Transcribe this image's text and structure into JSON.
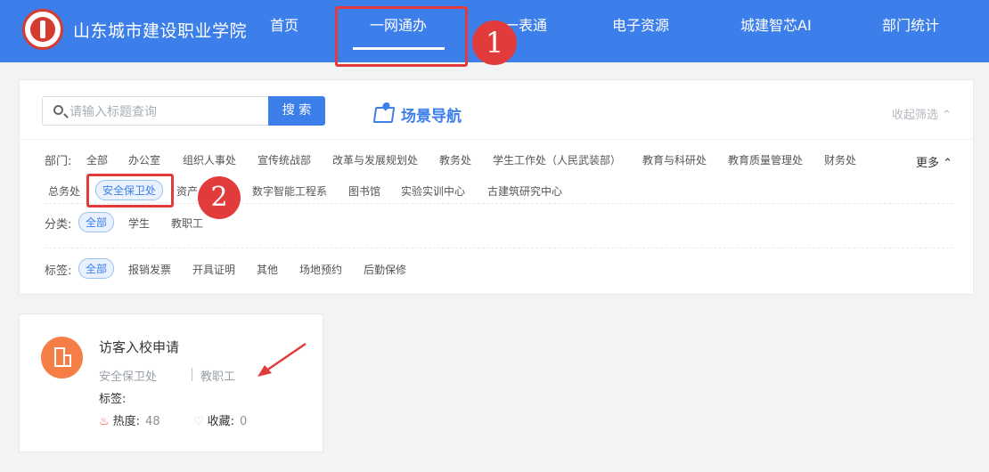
{
  "header": {
    "school_name": "山东城市建设职业学院",
    "nav": [
      "首页",
      "一网通办",
      "一表通",
      "电子资源",
      "城建智芯AI",
      "部门统计"
    ],
    "active_nav": "一网通办"
  },
  "annotations": [
    "1",
    "2"
  ],
  "search": {
    "placeholder": "请输入标题查询",
    "button_label": "搜 索"
  },
  "scene_nav_title": "场景导航",
  "collapse_label": "收起筛选",
  "filters": {
    "dept_label": "部门:",
    "dept_items": [
      "全部",
      "办公室",
      "组织人事处",
      "宣传统战部",
      "改革与发展规划处",
      "教务处",
      "学生工作处（人民武装部）",
      "教育与科研处",
      "教育质量管理处",
      "财务处",
      "总务处",
      "安全保卫处",
      "资产",
      "数字智能工程系",
      "图书馆",
      "实验实训中心",
      "古建筑研究中心"
    ],
    "dept_active": "安全保卫处",
    "more_label": "更多",
    "cat_label": "分类:",
    "cat_items": [
      "全部",
      "学生",
      "教职工"
    ],
    "cat_active": "全部",
    "tag_label": "标签:",
    "tag_items": [
      "全部",
      "报销发票",
      "开具证明",
      "其他",
      "场地预约",
      "后勤保修"
    ],
    "tag_active": "全部"
  },
  "card": {
    "title": "访客入校申请",
    "dept": "安全保卫处",
    "category": "教职工",
    "tags_label": "标签:",
    "hot_label": "热度:",
    "hot_value": "48",
    "fav_label": "收藏:",
    "fav_value": "0",
    "icon": "building-icon"
  },
  "colors": {
    "primary": "#3d7fea",
    "annotation_red": "#e23b3b",
    "card_icon": "#f47e45"
  }
}
